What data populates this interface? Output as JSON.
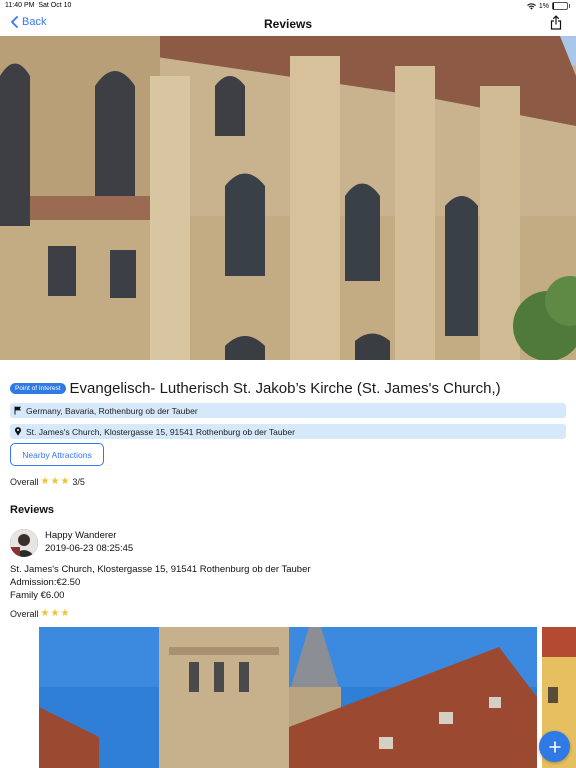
{
  "status": {
    "time": "11:40 PM",
    "date": "Sat Oct 10",
    "battery": "1%"
  },
  "nav": {
    "back_label": "Back",
    "title": "Reviews"
  },
  "place": {
    "badge": "Point of Interest",
    "name": "Evangelisch- Lutherisch St. Jakob’s Kirche (St. James's Church,)",
    "region": "Germany, Bavaria, Rothenburg ob der Tauber",
    "address": "St. James's Church, Klostergasse 15, 91541 Rothenburg ob der Tauber",
    "nearby_label": "Nearby Attractions",
    "overall_label": "Overall",
    "rating_text": "3/5",
    "rating": 3
  },
  "reviews": {
    "title": "Reviews",
    "items": [
      {
        "author": "Happy Wanderer",
        "timestamp": "2019-06-23 08:25:45",
        "text_lines": [
          "St. James's Church, Klostergasse 15, 91541 Rothenburg ob der Tauber",
          "Admission:€2.50",
          "Family €6.00"
        ],
        "overall_label": "Overall",
        "rating": 3
      }
    ]
  },
  "colors": {
    "accent": "#3478f6",
    "badge": "#2f7ae5",
    "info_bg": "#d5e9fb",
    "star": "#f1c232"
  },
  "icons": {
    "back": "chevron-left-icon",
    "share": "share-icon",
    "flag": "flag-icon",
    "pin": "location-pin-icon",
    "fab": "plus-icon"
  }
}
